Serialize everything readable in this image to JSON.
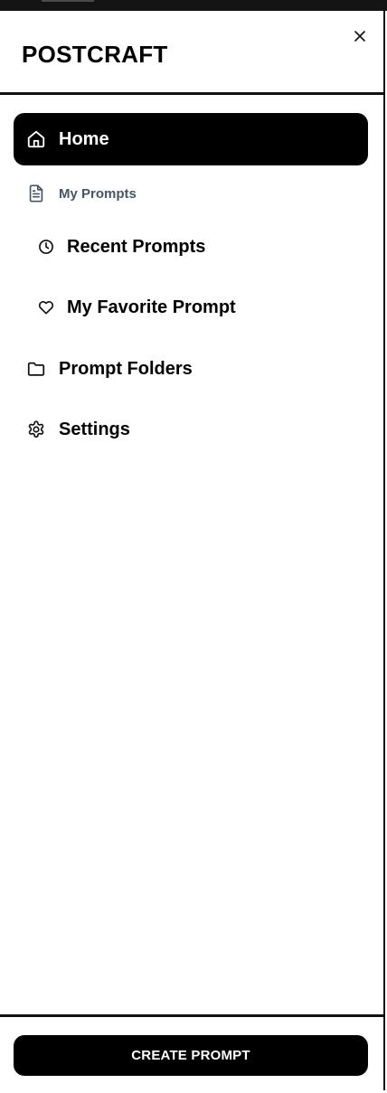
{
  "app": {
    "brand": "POSTCRAFT"
  },
  "nav": {
    "home": {
      "label": "Home",
      "icon": "home-icon",
      "active": true
    },
    "my_prompts": {
      "label": "My Prompts",
      "icon": "document-icon"
    },
    "recent_prompts": {
      "label": "Recent Prompts",
      "icon": "clock-icon"
    },
    "favorite_prompt": {
      "label": "My Favorite Prompt",
      "icon": "heart-icon"
    },
    "prompt_folders": {
      "label": "Prompt Folders",
      "icon": "folder-icon"
    },
    "settings": {
      "label": "Settings",
      "icon": "gear-icon"
    }
  },
  "footer": {
    "create_label": "CREATE PROMPT"
  },
  "colors": {
    "accent": "#000000",
    "muted_text": "#475569",
    "border": "#111111"
  }
}
